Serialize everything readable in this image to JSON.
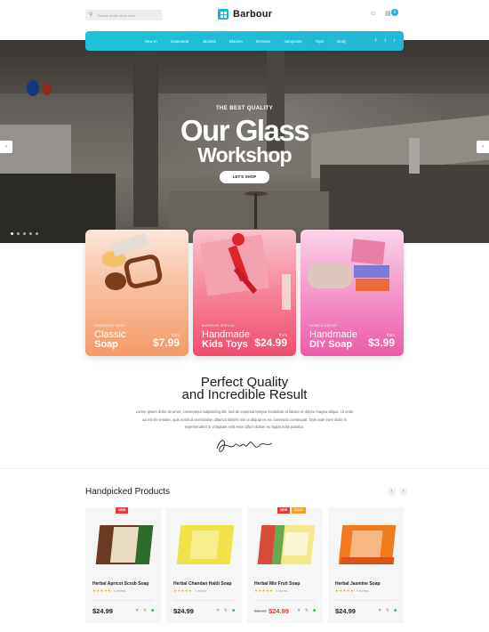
{
  "header": {
    "search_placeholder": "Search entire store here",
    "logo_text": "Barbour",
    "cart_count": "0"
  },
  "nav": {
    "items": [
      "New In",
      "Outerwear",
      "Jackets",
      "Blazers",
      "Dresses",
      "Jumpsuits",
      "Tops",
      "Body"
    ],
    "social": [
      "f",
      "t",
      "i"
    ]
  },
  "hero": {
    "kicker": "THE BEST QUALITY",
    "title_line1": "Our Glass",
    "title_line2": "Workshop",
    "button": "LET'S SHOP",
    "slides": 5,
    "active_slide": 0
  },
  "categories": [
    {
      "kicker": "HANDMADE SOAP",
      "line1": "Classic",
      "line2": "Soap",
      "from": "from",
      "price": "$7.99",
      "accent": "#f39a6a"
    },
    {
      "kicker": "BARBOUR SPECIAL",
      "line1": "Handmade",
      "line2": "Kids Toys",
      "from": "from",
      "price": "$24.99",
      "accent": "#f04d6e"
    },
    {
      "kicker": "HOME & DECOR",
      "line1": "Handmade",
      "line2": "DIY Soap",
      "from": "from",
      "price": "$3.99",
      "accent": "#ee5aa8"
    }
  ],
  "intro": {
    "title_line1": "Perfect Quality",
    "title_line2": "and Incredible Result",
    "body": "Lorem ipsum dolor sit amet, consectetur adipisicing elit, sed do eiusmod tempor incididunt ut labore et dolore magna aliqua. Ut enim ad minim veniam, quis nostrud exercitation ullamco laboris nisi ut aliquip ex ea commodo consequat. Duis aute irure dolor in reprehenderit in voluptate velit esse cillum dolore eu fugiat nulla pariatur."
  },
  "products_section": {
    "title": "Handpicked Products",
    "items": [
      {
        "name": "Herbal Apricot Scrub Soap",
        "price": "$24.99",
        "old_price": "",
        "badges": [
          "NEW"
        ],
        "rating": 5,
        "reviews": "0 reviews",
        "color": "#6b3a22",
        "band": "#2d6b2a"
      },
      {
        "name": "Herbal Chandan Haldi Soap",
        "price": "$24.99",
        "old_price": "",
        "badges": [],
        "rating": 5,
        "reviews": "0 reviews",
        "color": "#f2e24a",
        "band": "#e8c830"
      },
      {
        "name": "Herbal Mix Fruit Soap",
        "price": "$24.99",
        "old_price": "$36.99",
        "badges": [
          "NEW",
          "SALE"
        ],
        "rating": 5,
        "reviews": "0 reviews",
        "color": "#f4e88a",
        "band": "#d84b3a"
      },
      {
        "name": "Herbal Jasmine Soap",
        "price": "$24.99",
        "old_price": "",
        "badges": [],
        "rating": 5,
        "reviews": "0 reviews",
        "color": "#f07a1e",
        "band": "#d9531a"
      }
    ]
  }
}
